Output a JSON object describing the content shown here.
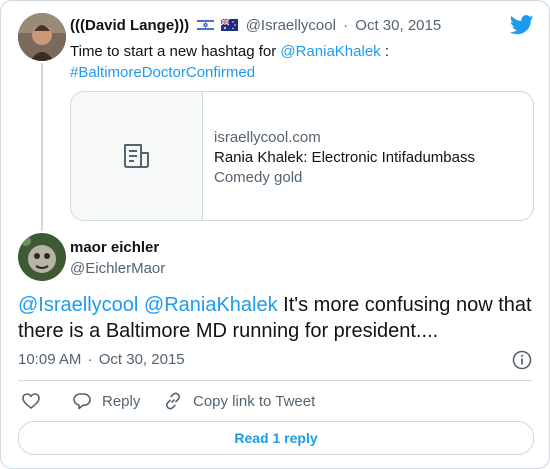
{
  "parent_tweet": {
    "display_name": "(((David Lange)))",
    "handle": "@Israellycool",
    "separator": "·",
    "date": "Oct 30, 2015",
    "text_prefix": "Time to start a new hashtag for ",
    "mention": "@RaniaKhalek",
    "text_suffix": " :",
    "hashtag": "#BaltimoreDoctorConfirmed",
    "link_card": {
      "domain": "israellycool.com",
      "title": "Rania Khalek: Electronic Intifadumbass",
      "description": "Comedy gold"
    }
  },
  "reply_tweet": {
    "display_name": "maor eichler",
    "handle": "@EichlerMaor",
    "mention1": "@Israellycool",
    "mention2": "@RaniaKhalek",
    "text": " It's more confusing now that there is a Baltimore MD running for president....",
    "time": "10:09 AM",
    "separator": "·",
    "date": "Oct 30, 2015"
  },
  "actions": {
    "reply_label": "Reply",
    "copy_link_label": "Copy link to Tweet"
  },
  "read_replies_label": "Read 1 reply",
  "colors": {
    "accent": "#1d9bf0",
    "muted": "#536471",
    "border": "#cfd9de"
  },
  "icons": [
    "twitter-bird-icon",
    "document-icon",
    "info-icon",
    "heart-icon",
    "reply-icon",
    "link-icon"
  ]
}
